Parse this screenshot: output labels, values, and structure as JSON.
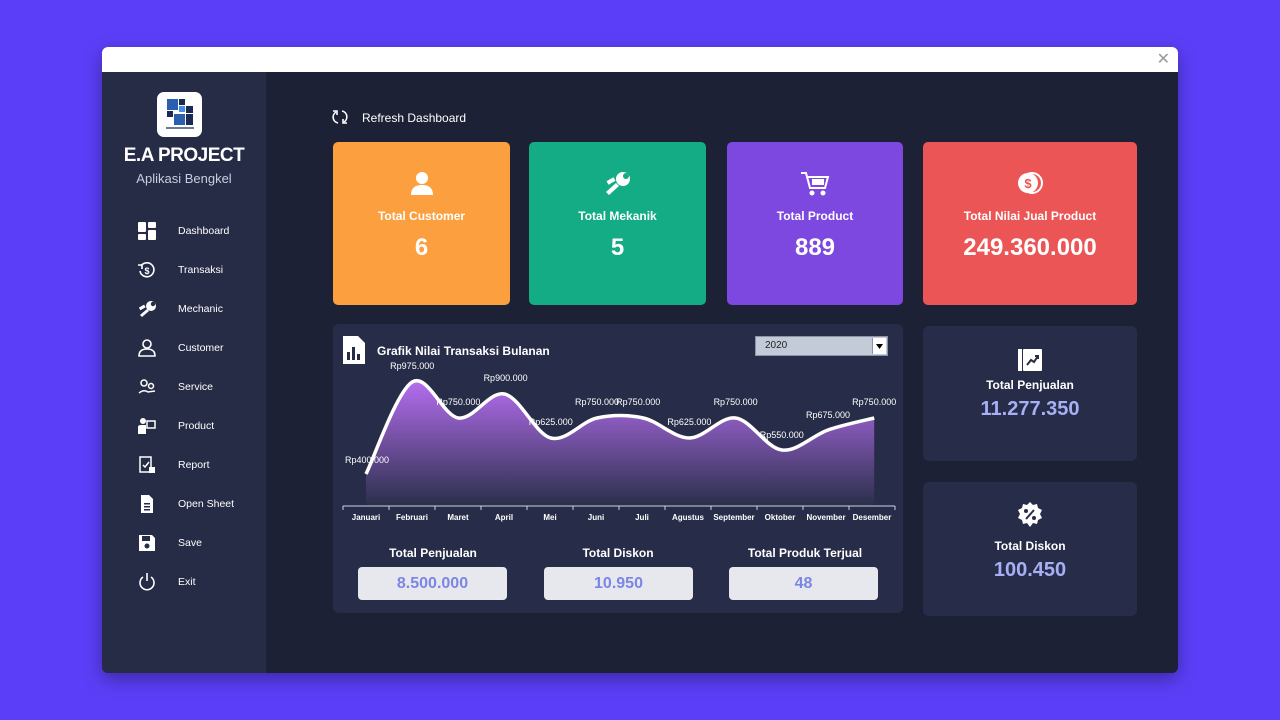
{
  "app": {
    "brand": "E.A PROJECT",
    "subtitle": "Aplikasi Bengkel"
  },
  "sidebar": {
    "items": [
      {
        "label": "Dashboard",
        "icon": "dashboard-grid-icon"
      },
      {
        "label": "Transaksi",
        "icon": "money-cycle-icon"
      },
      {
        "label": "Mechanic",
        "icon": "wrench-icon"
      },
      {
        "label": "Customer",
        "icon": "user-icon"
      },
      {
        "label": "Service",
        "icon": "service-icon"
      },
      {
        "label": "Product",
        "icon": "product-icon"
      },
      {
        "label": "Report",
        "icon": "report-icon"
      },
      {
        "label": "Open Sheet",
        "icon": "sheet-icon"
      },
      {
        "label": "Save",
        "icon": "save-icon"
      },
      {
        "label": "Exit",
        "icon": "power-icon"
      }
    ]
  },
  "toolbar": {
    "refresh_label": "Refresh Dashboard"
  },
  "stats": [
    {
      "label": "Total Customer",
      "value": "6",
      "color": "#fb9f3f",
      "icon": "user-icon"
    },
    {
      "label": "Total Mekanik",
      "value": "5",
      "color": "#14ac84",
      "icon": "wrench-icon"
    },
    {
      "label": "Total Product",
      "value": "889",
      "color": "#7c48e0",
      "icon": "cart-icon"
    },
    {
      "label": "Total Nilai Jual Product",
      "value": "249.360.000",
      "color": "#ec5556",
      "icon": "coin-icon"
    }
  ],
  "chart_panel": {
    "title": "Grafik Nilai Transaksi Bulanan",
    "year": "2020",
    "summary": [
      {
        "label": "Total Penjualan",
        "value": "8.500.000"
      },
      {
        "label": "Total Diskon",
        "value": "10.950"
      },
      {
        "label": "Total Produk Terjual",
        "value": "48"
      }
    ]
  },
  "chart_data": {
    "type": "area",
    "categories": [
      "Januari",
      "Februari",
      "Maret",
      "April",
      "Mei",
      "Juni",
      "Juli",
      "Agustus",
      "September",
      "Oktober",
      "November",
      "Desember"
    ],
    "values": [
      400000,
      975000,
      750000,
      900000,
      625000,
      750000,
      750000,
      625000,
      750000,
      550000,
      675000,
      750000
    ],
    "data_labels": [
      "Rp400.000",
      "Rp975.000",
      "Rp750.000",
      "Rp900.000",
      "Rp625.000",
      "Rp750.000",
      "Rp750.000",
      "Rp625.000",
      "Rp750.000",
      "Rp550.000",
      "Rp675.000",
      "Rp750.000"
    ],
    "title": "",
    "xlabel": "",
    "ylabel": "",
    "grid": false,
    "colors": {
      "area_top": "#b56ef0",
      "area_bottom": "#2a2f4a",
      "line": "#ffffff"
    }
  },
  "side_cards": [
    {
      "label": "Total Penjualan",
      "value": "11.277.350",
      "icon": "sales-chart-icon"
    },
    {
      "label": "Total Diskon",
      "value": "100.450",
      "icon": "percent-badge-icon"
    }
  ]
}
